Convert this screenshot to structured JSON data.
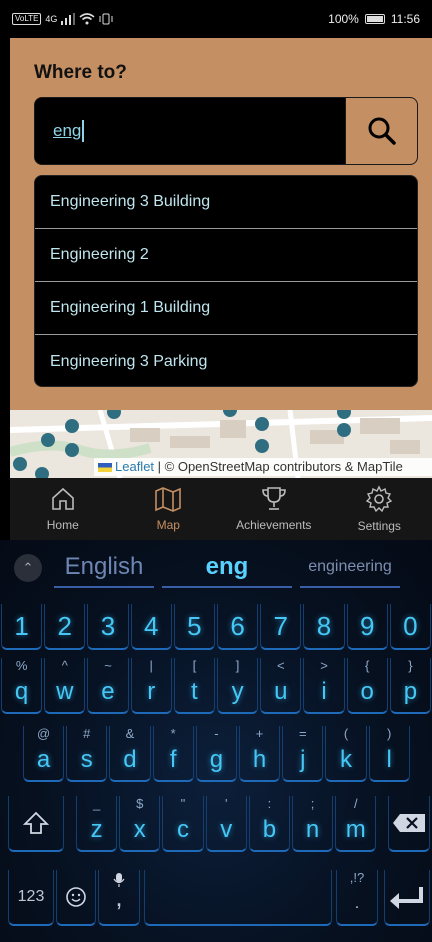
{
  "status": {
    "carrier_badge": "VoLTE",
    "network": "4G",
    "battery": "100%",
    "time": "11:56"
  },
  "search": {
    "title": "Where to?",
    "query": "eng",
    "suggestions": [
      "Engineering 3 Building",
      "Engineering 2",
      "Engineering 1 Building",
      "Engineering 3 Parking"
    ]
  },
  "map": {
    "attribution_leaflet": "Leaflet",
    "attribution_rest": " | © OpenStreetMap contributors & MapTile"
  },
  "nav": {
    "items": [
      {
        "label": "Home",
        "icon": "home-icon"
      },
      {
        "label": "Map",
        "icon": "map-icon"
      },
      {
        "label": "Achievements",
        "icon": "trophy-icon"
      },
      {
        "label": "Settings",
        "icon": "gear-icon"
      }
    ],
    "active": "Map"
  },
  "keyboard": {
    "suggestions": [
      "English",
      "eng",
      "engineering"
    ],
    "numbers": [
      "1",
      "2",
      "3",
      "4",
      "5",
      "6",
      "7",
      "8",
      "9",
      "0"
    ],
    "row1": [
      {
        "k": "q",
        "h": "%"
      },
      {
        "k": "w",
        "h": "^"
      },
      {
        "k": "e",
        "h": "~"
      },
      {
        "k": "r",
        "h": "|"
      },
      {
        "k": "t",
        "h": "["
      },
      {
        "k": "y",
        "h": "]"
      },
      {
        "k": "u",
        "h": "<"
      },
      {
        "k": "i",
        "h": ">"
      },
      {
        "k": "o",
        "h": "{"
      },
      {
        "k": "p",
        "h": "}"
      }
    ],
    "row2": [
      {
        "k": "a",
        "h": "@"
      },
      {
        "k": "s",
        "h": "#"
      },
      {
        "k": "d",
        "h": "&"
      },
      {
        "k": "f",
        "h": "*"
      },
      {
        "k": "g",
        "h": "-"
      },
      {
        "k": "h",
        "h": "+"
      },
      {
        "k": "j",
        "h": "="
      },
      {
        "k": "k",
        "h": "("
      },
      {
        "k": "l",
        "h": ")"
      }
    ],
    "row3": [
      {
        "k": "z",
        "h": "_"
      },
      {
        "k": "x",
        "h": "$"
      },
      {
        "k": "c",
        "h": "\""
      },
      {
        "k": "v",
        "h": "'"
      },
      {
        "k": "b",
        "h": ":"
      },
      {
        "k": "n",
        "h": ";"
      },
      {
        "k": "m",
        "h": "/"
      }
    ],
    "num_key": "123",
    "comma": ",",
    "period": ".",
    "period_hint": ",!?"
  },
  "colors": {
    "panel": "#c48f63",
    "key_text": "#45c8f5",
    "suggestion_text": "#bfe6ee"
  }
}
